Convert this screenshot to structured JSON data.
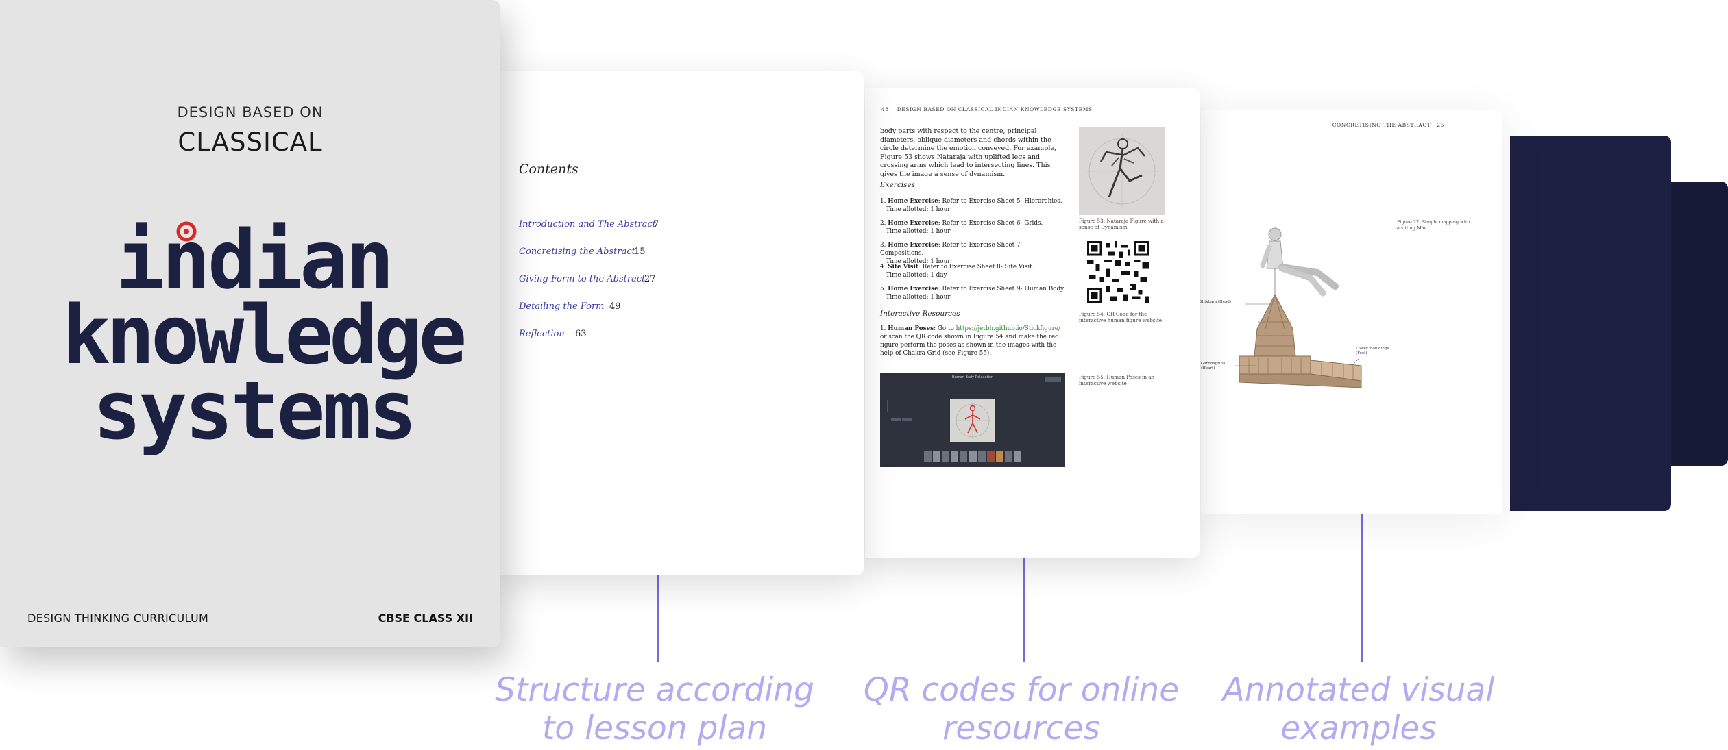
{
  "cover": {
    "subtitle": "DESIGN BASED ON",
    "title": "CLASSICAL",
    "logo_lines": [
      "indian",
      "knowledge",
      "systems"
    ],
    "footer_left": "DESIGN THINKING CURRICULUM",
    "footer_right": "CBSE CLASS XII"
  },
  "toc": {
    "heading": "Contents",
    "items": [
      {
        "label": "Introduction and The Abstract",
        "page": "7"
      },
      {
        "label": "Concretising the Abstract",
        "page": "15"
      },
      {
        "label": "Giving Form to the Abstract",
        "page": "27"
      },
      {
        "label": "Detailing the Form",
        "page": "49"
      },
      {
        "label": "Reflection",
        "page": "63"
      }
    ]
  },
  "mid_page": {
    "page_number": "48",
    "running_head": "DESIGN BASED ON CLASSICAL INDIAN KNOWLEDGE SYSTEMS",
    "intro": "body parts with respect to the centre, principal diameters, oblique diameters and chords within the circle determine the emotion conveyed. For example, Figure 53 shows Nataraja with uplifted legs and crossing arms which lead to intersecting lines. This gives the image a sense of dynamism.",
    "exercises_heading": "Exercises",
    "exercises": [
      {
        "n": "1.",
        "kind": "Home Exercise",
        "text": ": Refer to Exercise Sheet 5- Hierarchies.",
        "time": "Time allotted: 1 hour"
      },
      {
        "n": "2.",
        "kind": "Home Exercise",
        "text": ": Refer to Exercise Sheet 6- Grids.",
        "time": "Time allotted: 1 hour"
      },
      {
        "n": "3.",
        "kind": "Home Exercise",
        "text": ": Refer to Exercise Sheet 7- Compositions.",
        "time": "Time allotted: 1 hour"
      },
      {
        "n": "4.",
        "kind": "Site Visit",
        "text": ": Refer to Exercise Sheet 8- Site Visit.",
        "time": "Time allotted: 1 day"
      },
      {
        "n": "5.",
        "kind": "Home Exercise",
        "text": ": Refer to Exercise Sheet 9- Human Body.",
        "time": "Time allotted: 1 hour"
      }
    ],
    "resources_heading": "Interactive Resources",
    "resource": {
      "n": "1.",
      "kind": "Human Poses",
      "pre": ": Go to ",
      "link": "https://jetbh.github.io/Stickfigure/",
      "post": " or scan the QR code shown in Figure 54 and make the red figure perform the poses as shown in the images with the help of Chakra Grid (see Figure 55)."
    },
    "fig53_caption": "Figure 53: Nataraja Figure with a sense of Dynamism",
    "fig54_caption": "Figure 54: QR Code for the interactive human figure website",
    "fig55_caption": "Figure 55: Human Poses in an interactive website",
    "screenshot_title": "Human Body Relaxation"
  },
  "right_page": {
    "running_head": "CONCRETISING THE ABSTRACT",
    "page_number": "25",
    "caption": "Figure 22: Simple mapping with a sitting Man",
    "labels": {
      "head": "Shikhara (Head)",
      "heart": "Garbhagriha (Heart)",
      "feet": "Lower mouldings (Feet)"
    }
  },
  "callouts": [
    {
      "line1": "Structure according",
      "line2": "to lesson plan"
    },
    {
      "line1": "QR codes for online",
      "line2": "resources"
    },
    {
      "line1": "Annotated visual",
      "line2": "examples"
    }
  ],
  "colors": {
    "accent": "#7c68dd",
    "callout_text": "#b4aaf2",
    "navy": "#1d2042",
    "link": "#3a3aa8"
  }
}
